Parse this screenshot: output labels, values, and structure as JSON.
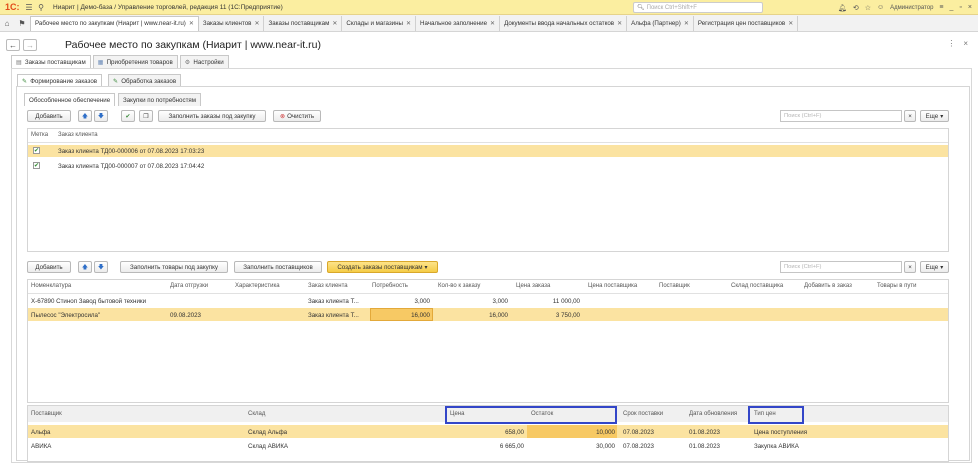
{
  "app": {
    "name": "Ниарит | Демо-база / Управление торговлей, редакция 11  (1С:Предприятие)",
    "search_placeholder": "Поиск Ctrl+Shift+F",
    "user": "Администратор"
  },
  "tabs": [
    {
      "label": "Рабочее место по закупкам (Ниарит | www.near-it.ru)"
    },
    {
      "label": "Заказы клиентов"
    },
    {
      "label": "Заказы поставщикам"
    },
    {
      "label": "Склады и магазины"
    },
    {
      "label": "Начальное заполнение"
    },
    {
      "label": "Документы ввода начальных остатков"
    },
    {
      "label": "Альфа (Партнер)"
    },
    {
      "label": "Регистрация цен поставщиков"
    }
  ],
  "page": {
    "title": "Рабочее место по закупкам (Ниарит | www.near-it.ru)"
  },
  "form_tabs": [
    "Заказы поставщикам",
    "Приобретения товаров",
    "Настройки"
  ],
  "sub_tabs": [
    "Формирование заказов",
    "Обработка заказов"
  ],
  "inner_tabs": [
    "Обособленное обеспечение",
    "Закупки по потребностям"
  ],
  "toolbar1": {
    "add": "Добавить",
    "fill": "Заполнить заказы под закупку",
    "clear": "Очистить",
    "search_placeholder": "Поиск (Ctrl+F)",
    "more": "Еще"
  },
  "orders_table": {
    "headers": [
      "Метка",
      "Заказ клиента"
    ],
    "rows": [
      {
        "checked": true,
        "order": "Заказ клиента ТД00-000006 от 07.08.2023 17:03:23"
      },
      {
        "checked": true,
        "order": "Заказ клиента ТД00-000007 от 07.08.2023 17:04:42"
      }
    ]
  },
  "toolbar2": {
    "add": "Добавить",
    "fill_goods": "Заполнить товары под закупку",
    "fill_suppliers": "Заполнить поставщиков",
    "create_orders": "Создать заказы поставщикам",
    "search_placeholder": "Поиск (Ctrl+F)",
    "more": "Еще"
  },
  "goods_table": {
    "headers": [
      "Номенклатура",
      "Дата отгрузки",
      "Характеристика",
      "Заказ клиента",
      "Потребность",
      "Кол-во к заказу",
      "Цена заказа",
      "Цена поставщика",
      "Поставщик",
      "Склад поставщика",
      "Добавить в заказ",
      "Товары в пути"
    ],
    "rows": [
      {
        "item": "X-67890 Стиноп Завод бытовой техники",
        "date": "",
        "char": "",
        "order": "Заказ клиента Т...",
        "need": "3,000",
        "qty": "3,000",
        "price": "11 000,00"
      },
      {
        "item": "Пылесос \"Электросила\"",
        "date": "09.08.2023",
        "char": "",
        "order": "Заказ клиента Т...",
        "need": "16,000",
        "qty": "16,000",
        "price": "3 750,00"
      }
    ]
  },
  "suppliers_table": {
    "headers": [
      "Поставщик",
      "Склад",
      "Цена",
      "Остаток",
      "Срок поставки",
      "Дата обновления",
      "Тип цен"
    ],
    "rows": [
      {
        "supplier": "Альфа",
        "warehouse": "Склад Альфа",
        "price": "658,00",
        "rest": "10,000",
        "term": "07.08.2023",
        "updated": "01.08.2023",
        "price_type": "Цена поступления"
      },
      {
        "supplier": "АВИКА",
        "warehouse": "Склад АВИКА",
        "price": "6 665,00",
        "rest": "30,000",
        "term": "07.08.2023",
        "updated": "01.08.2023",
        "price_type": "Закупка АВИКА"
      }
    ]
  },
  "colors": {
    "titlebar": "#fbeea0",
    "selected_row": "#fbe3a1",
    "highlight_box": "#3346c8",
    "accent_button": "#f5cc47"
  }
}
